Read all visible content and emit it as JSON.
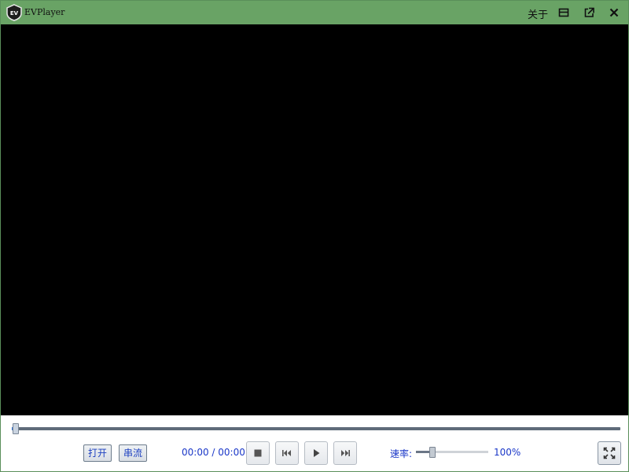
{
  "window": {
    "title": "EVPlayer",
    "logo_text": "EV",
    "about_label": "关于",
    "titlebar_color": "#69a365",
    "icons": [
      "minimize-icon",
      "popout-icon",
      "close-icon"
    ]
  },
  "video": {
    "background": "#000000"
  },
  "seek": {
    "progress": 0.007
  },
  "controls": {
    "open_label": "打开",
    "stream_label": "串流",
    "time_display": "00:00 / 00:00",
    "buttons": [
      "stop-icon",
      "previous-icon",
      "play-icon",
      "next-icon"
    ],
    "rate_label": "速率:",
    "rate_value": "100%",
    "rate_level": 0.2,
    "fullscreen_icon": "fullscreen-icon",
    "accent_color": "#1a37c8"
  }
}
